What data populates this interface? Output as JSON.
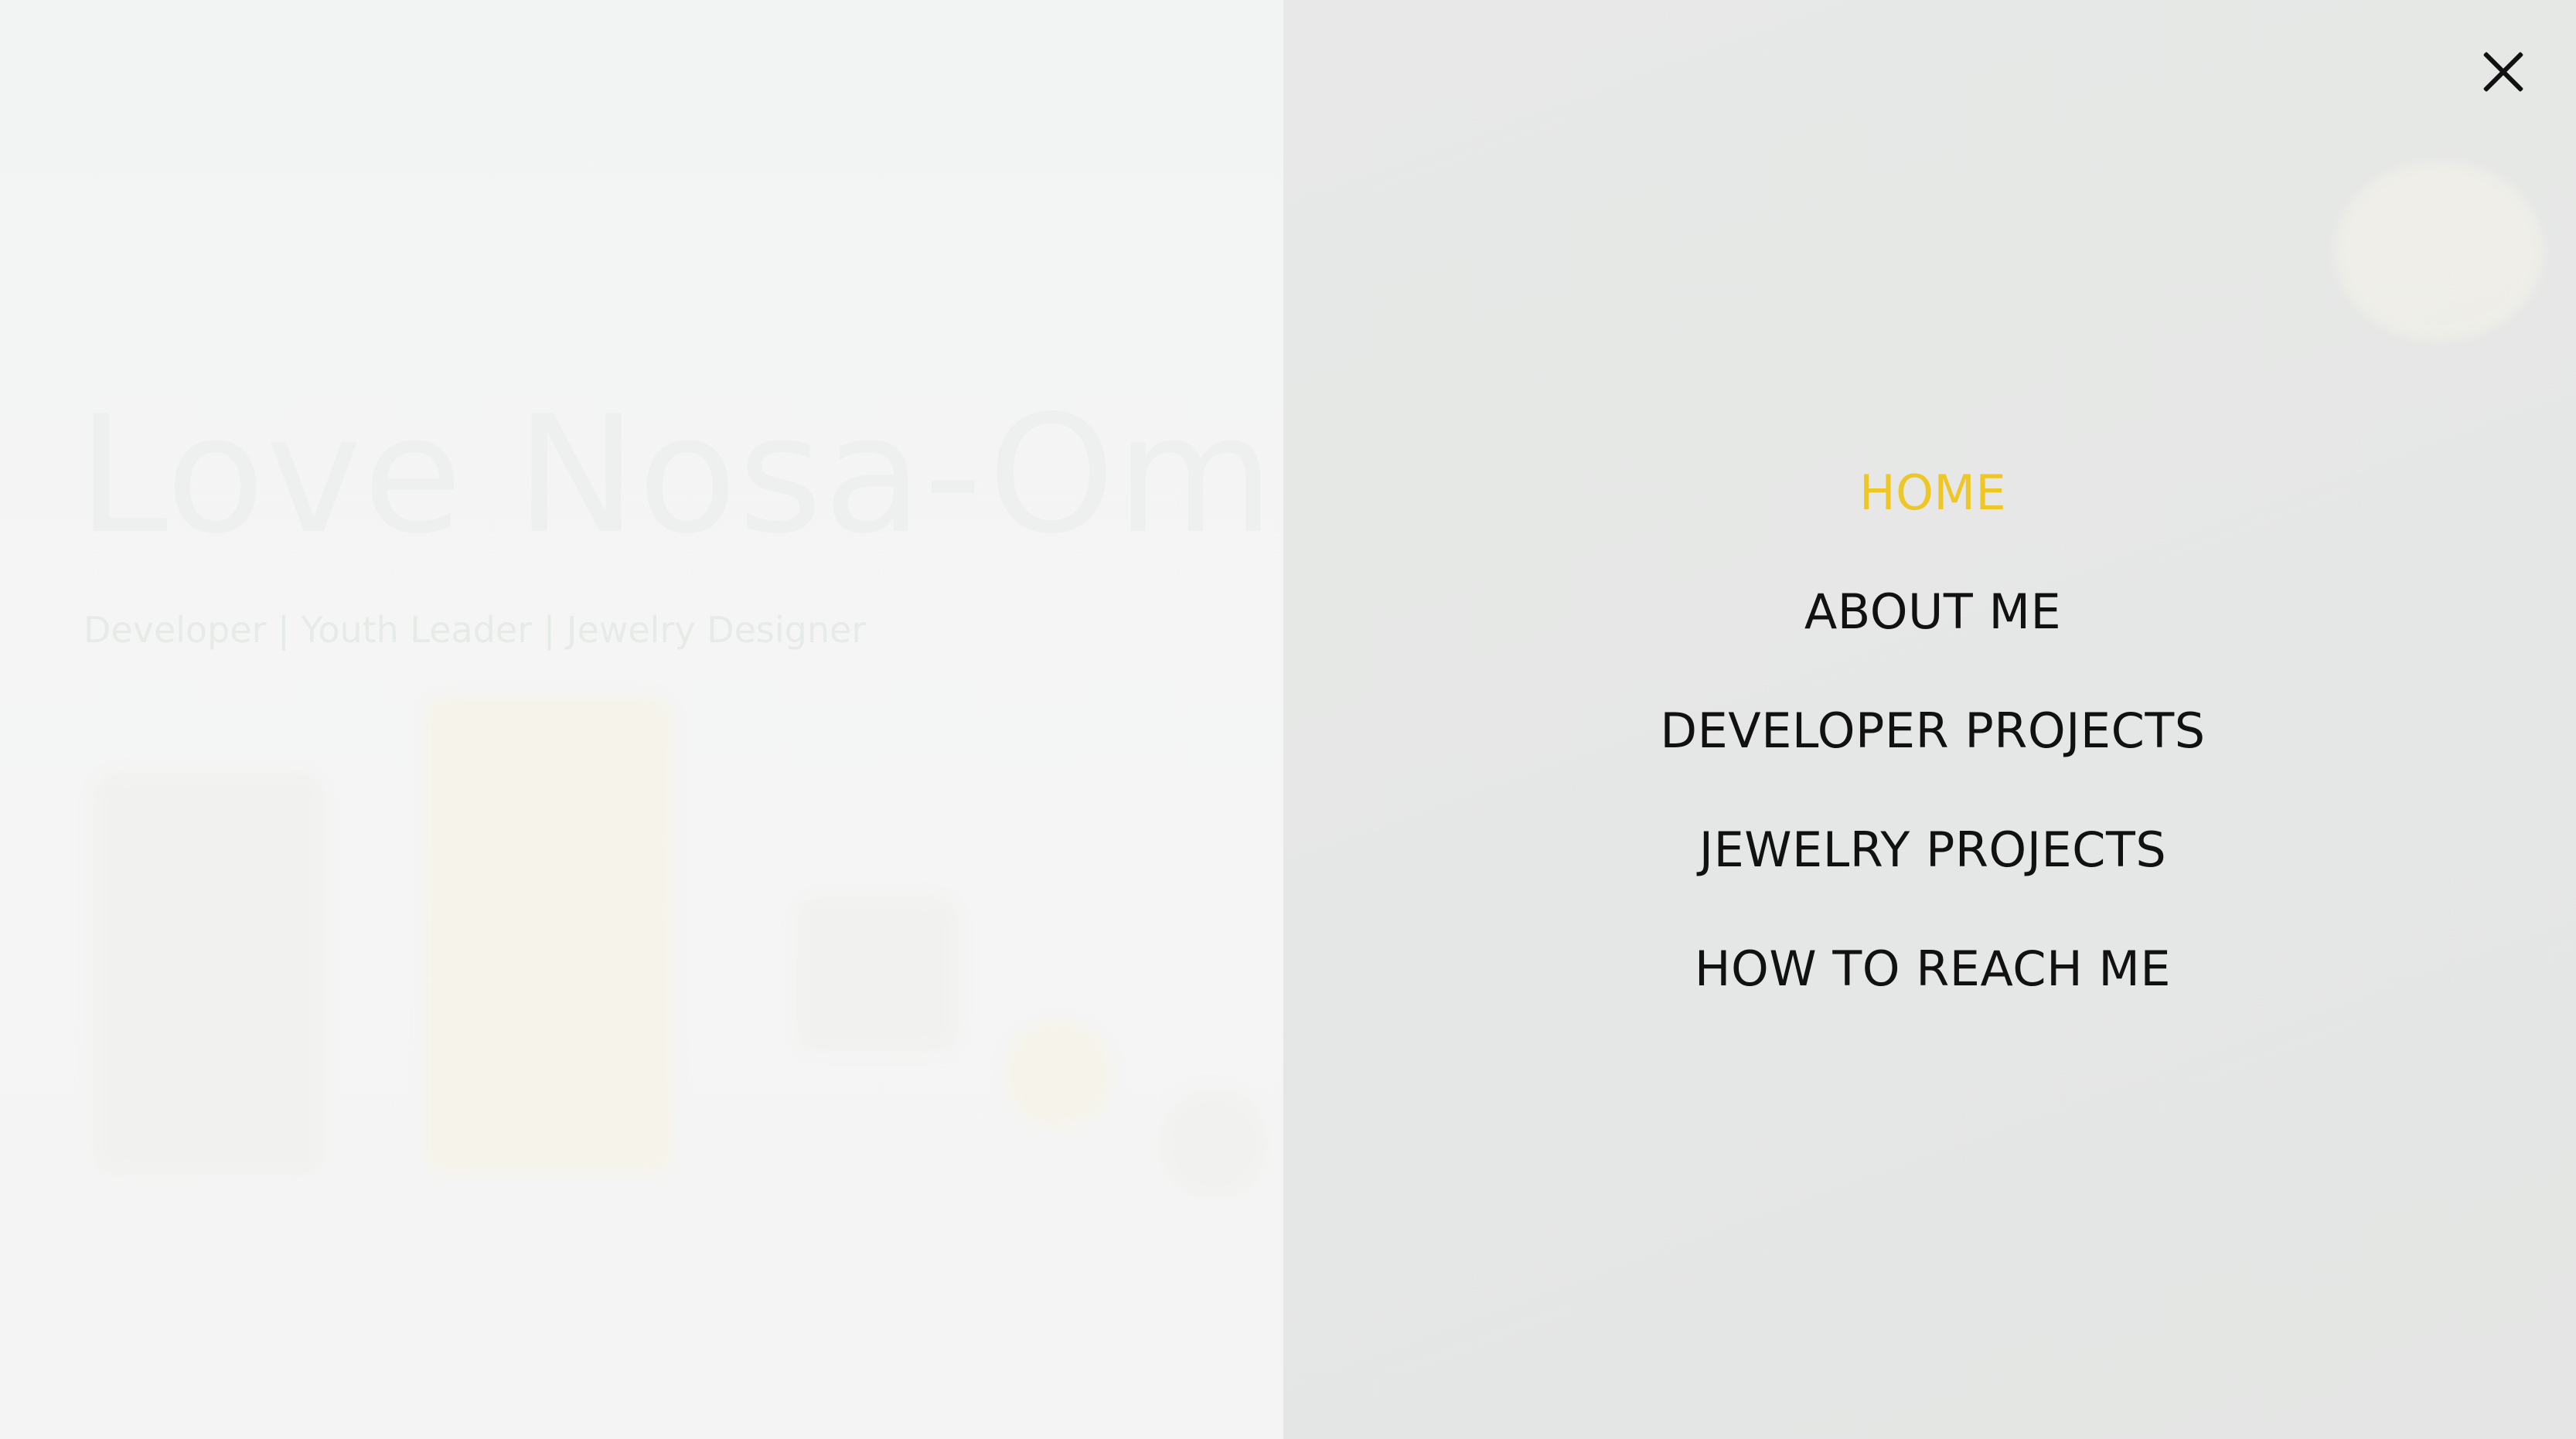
{
  "hero": {
    "title": "Love Nosa-Omorogiuwa",
    "subtitle": "Developer | Youth Leader | Jewelry Designer"
  },
  "menu": {
    "close_icon": "close-icon",
    "close_label": "Close menu",
    "items": [
      {
        "label": "HOME",
        "active": true
      },
      {
        "label": "ABOUT ME",
        "active": false
      },
      {
        "label": "DEVELOPER PROJECTS",
        "active": false
      },
      {
        "label": "JEWELRY PROJECTS",
        "active": false
      },
      {
        "label": "HOW TO REACH ME",
        "active": false
      }
    ]
  },
  "colors": {
    "overlay_bg": "#e5e7e6",
    "active_link": "#eec726",
    "link": "#111111",
    "hero_bg": "#f3f4f4"
  }
}
